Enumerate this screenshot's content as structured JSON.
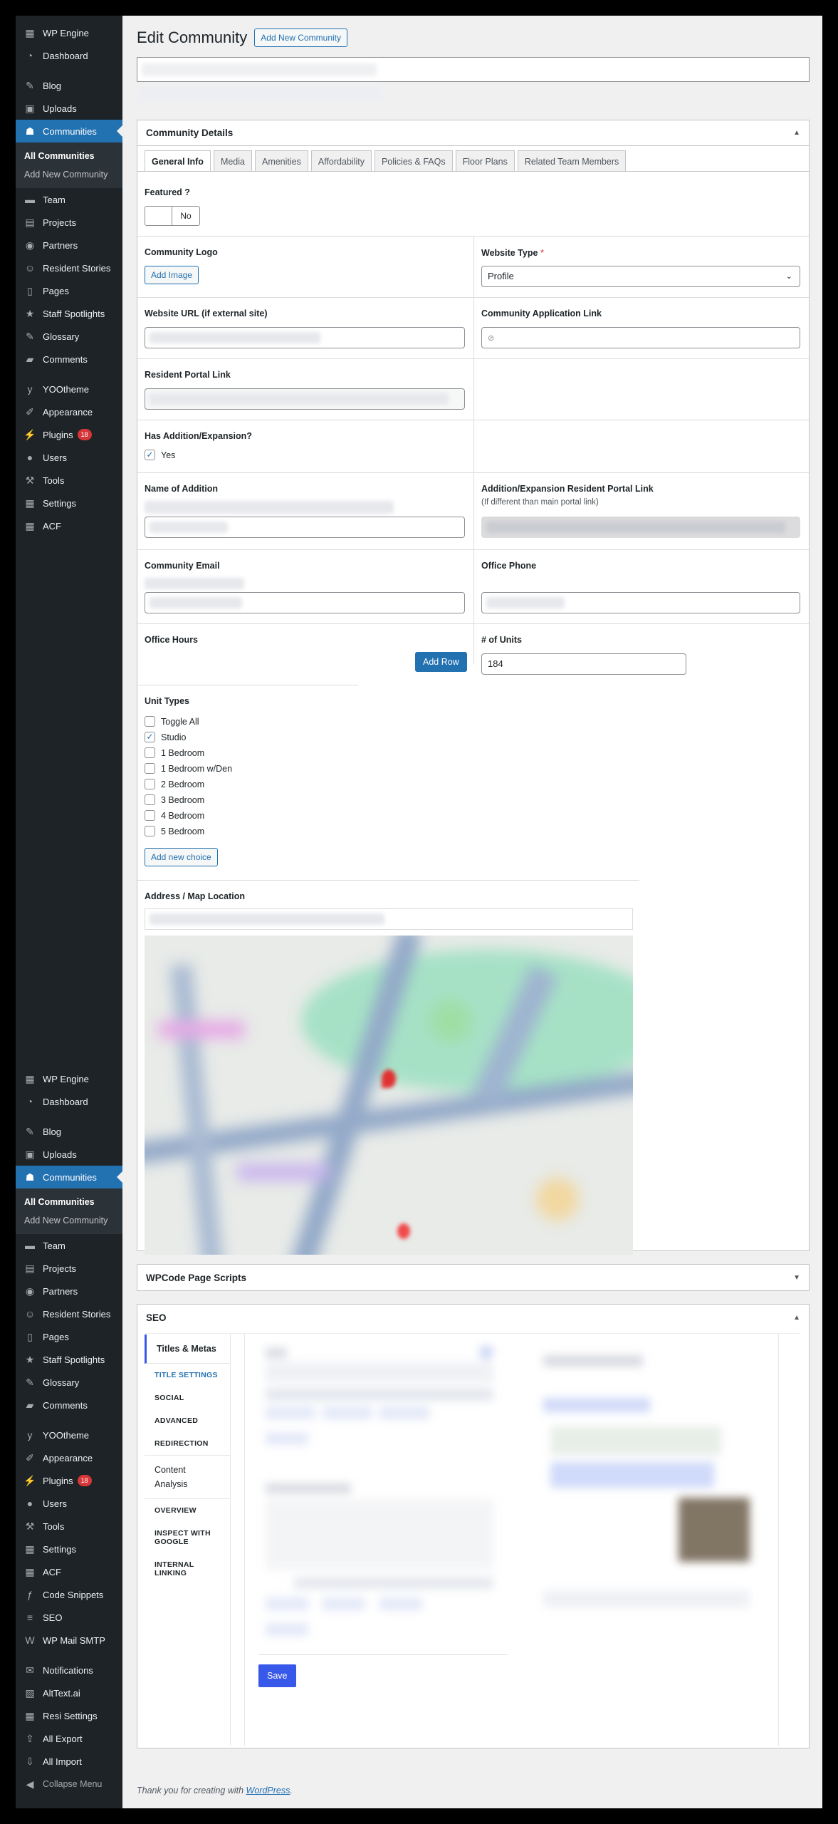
{
  "sidebar": {
    "top": [
      {
        "label": "WP Engine",
        "icon": "wp-engine-icon"
      },
      {
        "label": "Dashboard",
        "icon": "dashboard-icon"
      },
      {
        "gap": true
      },
      {
        "label": "Blog",
        "icon": "pin-icon"
      },
      {
        "label": "Uploads",
        "icon": "media-icon"
      },
      {
        "label": "Communities",
        "icon": "communities-icon",
        "active": true
      },
      {
        "sub": [
          "All Communities",
          "Add New Community"
        ]
      },
      {
        "label": "Team",
        "icon": "team-icon"
      },
      {
        "label": "Projects",
        "icon": "projects-icon"
      },
      {
        "label": "Partners",
        "icon": "partners-icon"
      },
      {
        "label": "Resident Stories",
        "icon": "smile-icon"
      },
      {
        "label": "Pages",
        "icon": "pages-icon"
      },
      {
        "label": "Staff Spotlights",
        "icon": "star-icon"
      },
      {
        "label": "Glossary",
        "icon": "pin-icon"
      },
      {
        "label": "Comments",
        "icon": "comment-icon"
      },
      {
        "gap": true
      },
      {
        "label": "YOOtheme",
        "icon": "yootheme-icon"
      },
      {
        "label": "Appearance",
        "icon": "brush-icon"
      },
      {
        "label": "Plugins",
        "icon": "plugin-icon",
        "badge": "18"
      },
      {
        "label": "Users",
        "icon": "user-icon"
      },
      {
        "label": "Tools",
        "icon": "wrench-icon"
      },
      {
        "label": "Settings",
        "icon": "settings-icon"
      },
      {
        "label": "ACF",
        "icon": "acf-icon"
      }
    ],
    "bottom": [
      {
        "label": "WP Engine",
        "icon": "wp-engine-icon"
      },
      {
        "label": "Dashboard",
        "icon": "dashboard-icon"
      },
      {
        "gap": true
      },
      {
        "label": "Blog",
        "icon": "pin-icon"
      },
      {
        "label": "Uploads",
        "icon": "media-icon"
      },
      {
        "label": "Communities",
        "icon": "communities-icon",
        "active": true
      },
      {
        "sub": [
          "All Communities",
          "Add New Community"
        ]
      },
      {
        "label": "Team",
        "icon": "team-icon"
      },
      {
        "label": "Projects",
        "icon": "projects-icon"
      },
      {
        "label": "Partners",
        "icon": "partners-icon"
      },
      {
        "label": "Resident Stories",
        "icon": "smile-icon"
      },
      {
        "label": "Pages",
        "icon": "pages-icon"
      },
      {
        "label": "Staff Spotlights",
        "icon": "star-icon"
      },
      {
        "label": "Glossary",
        "icon": "pin-icon"
      },
      {
        "label": "Comments",
        "icon": "comment-icon"
      },
      {
        "gap": true
      },
      {
        "label": "YOOtheme",
        "icon": "yootheme-icon"
      },
      {
        "label": "Appearance",
        "icon": "brush-icon"
      },
      {
        "label": "Plugins",
        "icon": "plugin-icon",
        "badge": "18"
      },
      {
        "label": "Users",
        "icon": "user-icon"
      },
      {
        "label": "Tools",
        "icon": "wrench-icon"
      },
      {
        "label": "Settings",
        "icon": "settings-icon"
      },
      {
        "label": "ACF",
        "icon": "acf-icon"
      },
      {
        "label": "Code Snippets",
        "icon": "code-icon"
      },
      {
        "label": "SEO",
        "icon": "seo-icon"
      },
      {
        "label": "WP Mail SMTP",
        "icon": "mail-icon"
      },
      {
        "gap": true
      },
      {
        "label": "Notifications",
        "icon": "envelope-icon"
      },
      {
        "label": "AltText.ai",
        "icon": "image-icon"
      },
      {
        "label": "Resi Settings",
        "icon": "settings-icon"
      },
      {
        "label": "All Export",
        "icon": "export-icon"
      },
      {
        "label": "All Import",
        "icon": "import-icon"
      },
      {
        "label": "Collapse Menu",
        "icon": "collapse-icon",
        "collapse": true
      }
    ]
  },
  "header": {
    "title": "Edit Community",
    "add_new": "Add New Community"
  },
  "details": {
    "title": "Community Details",
    "tabs": [
      "General Info",
      "Media",
      "Amenities",
      "Affordability",
      "Policies & FAQs",
      "Floor Plans",
      "Related Team Members"
    ],
    "featured_label": "Featured ?",
    "featured_toggle": "No",
    "logo_label": "Community Logo",
    "add_image": "Add Image",
    "website_type_label": "Website Type",
    "website_type_req": "*",
    "website_type_value": "Profile",
    "website_url_label": "Website URL (if external site)",
    "app_link_label": "Community Application Link",
    "portal_label": "Resident Portal Link",
    "expansion_label": "Has Addition/Expansion?",
    "expansion_value": "Yes",
    "addition_name_label": "Name of Addition",
    "addition_portal_label": "Addition/Expansion Resident Portal Link",
    "addition_portal_hint": "(If different than main portal link)",
    "email_label": "Community Email",
    "phone_label": "Office Phone",
    "hours_label": "Office Hours",
    "add_row": "Add Row",
    "units_label": "# of Units",
    "units_value": "184",
    "unit_types_label": "Unit Types",
    "unit_types": [
      {
        "label": "Toggle All",
        "checked": false
      },
      {
        "label": "Studio",
        "checked": true
      },
      {
        "label": "1 Bedroom",
        "checked": false
      },
      {
        "label": "1 Bedroom w/Den",
        "checked": false
      },
      {
        "label": "2 Bedroom",
        "checked": false
      },
      {
        "label": "3 Bedroom",
        "checked": false
      },
      {
        "label": "4 Bedroom",
        "checked": false
      },
      {
        "label": "5 Bedroom",
        "checked": false
      }
    ],
    "add_choice": "Add new choice",
    "address_label": "Address / Map Location"
  },
  "wpcode": {
    "title": "WPCode Page Scripts"
  },
  "seo": {
    "title": "SEO",
    "nav": [
      "Titles & Metas",
      "TITLE SETTINGS",
      "SOCIAL",
      "ADVANCED",
      "REDIRECTION",
      "Content Analysis",
      "OVERVIEW",
      "INSPECT WITH GOOGLE",
      "INTERNAL LINKING"
    ],
    "save": "Save"
  },
  "footer": {
    "text": "Thank you for creating with ",
    "link": "WordPress",
    "end": "."
  }
}
